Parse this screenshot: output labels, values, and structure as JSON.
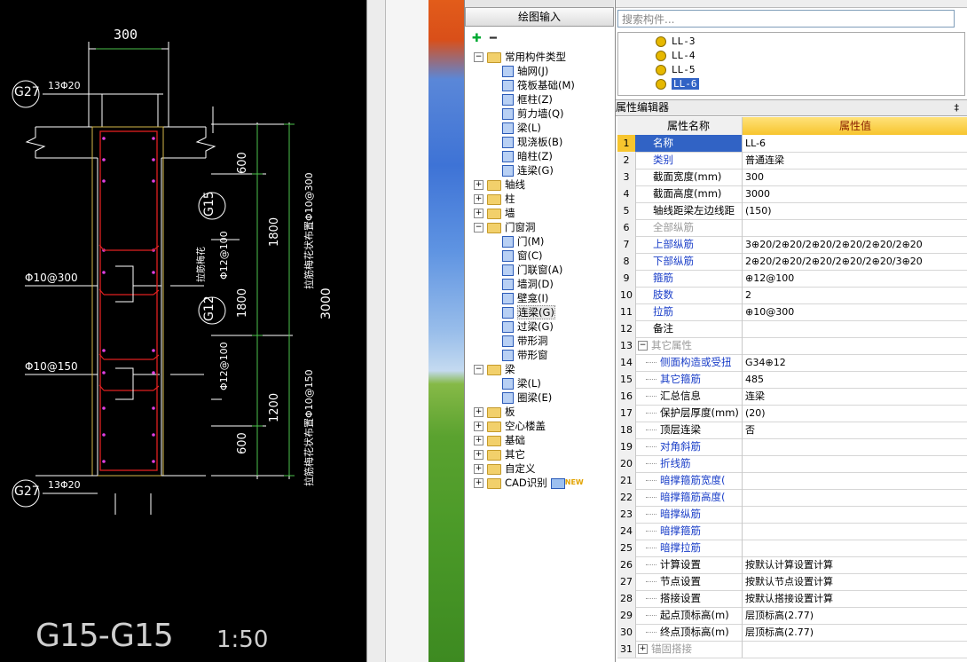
{
  "cad": {
    "dim_300": "300",
    "tag_g27_top": "G27",
    "rebar_top": "13Φ20",
    "tag_g15": "G15",
    "tag_g12": "G12",
    "tag_g27_bottom": "G27",
    "rebar_bottom": "13Φ20",
    "left_rebar_1": "Φ10@300",
    "left_rebar_2": "Φ10@150",
    "vert_rebar_1": "Φ12@100",
    "vert_rebar_2": "Φ12@100",
    "dim_600_top": "600",
    "dim_1800_a": "1800",
    "dim_1800_b": "1800",
    "dim_1200": "1200",
    "dim_600_bottom": "600",
    "dim_3000": "3000",
    "note_1": "拉筋梅花状布置Φ10@300",
    "note_2": "拉筋梅花状布置Φ10@150",
    "note_small": "拉筋梅花",
    "section_title": "G15-G15",
    "scale": "1:50"
  },
  "panel": {
    "draw_input": "绘图输入",
    "tree": [
      {
        "label": "常用构件类型",
        "type": "folder-open",
        "level": 0
      },
      {
        "label": "轴网(J)",
        "type": "item",
        "level": 1
      },
      {
        "label": "筏板基础(M)",
        "type": "item",
        "level": 1
      },
      {
        "label": "框柱(Z)",
        "type": "item",
        "level": 1
      },
      {
        "label": "剪力墙(Q)",
        "type": "item",
        "level": 1
      },
      {
        "label": "梁(L)",
        "type": "item",
        "level": 1
      },
      {
        "label": "现浇板(B)",
        "type": "item",
        "level": 1
      },
      {
        "label": "暗柱(Z)",
        "type": "item",
        "level": 1
      },
      {
        "label": "连梁(G)",
        "type": "item",
        "level": 1
      },
      {
        "label": "轴线",
        "type": "folder",
        "level": 0
      },
      {
        "label": "柱",
        "type": "folder",
        "level": 0
      },
      {
        "label": "墙",
        "type": "folder",
        "level": 0
      },
      {
        "label": "门窗洞",
        "type": "folder-open",
        "level": 0
      },
      {
        "label": "门(M)",
        "type": "item",
        "level": 1
      },
      {
        "label": "窗(C)",
        "type": "item",
        "level": 1
      },
      {
        "label": "门联窗(A)",
        "type": "item",
        "level": 1
      },
      {
        "label": "墙洞(D)",
        "type": "item",
        "level": 1
      },
      {
        "label": "壁龛(I)",
        "type": "item",
        "level": 1
      },
      {
        "label": "连梁(G)",
        "type": "item-selected",
        "level": 1
      },
      {
        "label": "过梁(G)",
        "type": "item",
        "level": 1
      },
      {
        "label": "带形洞",
        "type": "item",
        "level": 1
      },
      {
        "label": "带形窗",
        "type": "item",
        "level": 1
      },
      {
        "label": "梁",
        "type": "folder-open",
        "level": 0
      },
      {
        "label": "梁(L)",
        "type": "item",
        "level": 1
      },
      {
        "label": "圈梁(E)",
        "type": "item",
        "level": 1
      },
      {
        "label": "板",
        "type": "folder",
        "level": 0
      },
      {
        "label": "空心楼盖",
        "type": "folder",
        "level": 0
      },
      {
        "label": "基础",
        "type": "folder",
        "level": 0
      },
      {
        "label": "其它",
        "type": "folder",
        "level": 0
      },
      {
        "label": "自定义",
        "type": "folder",
        "level": 0
      },
      {
        "label": "CAD识别",
        "type": "folder-new",
        "level": 0
      }
    ],
    "new_badge": "NEW"
  },
  "right": {
    "search_placeholder": "搜索构件...",
    "components": [
      "LL-3",
      "LL-4",
      "LL-5",
      "LL-6"
    ],
    "selected_component": "LL-6",
    "editor_title": "属性编辑器",
    "col_name": "属性名称",
    "col_value": "属性值",
    "rows": [
      {
        "n": "1",
        "k": "名称",
        "v": "LL-6",
        "style": "sel"
      },
      {
        "n": "2",
        "k": "类别",
        "v": "普通连梁",
        "style": "blue"
      },
      {
        "n": "3",
        "k": "截面宽度(mm)",
        "v": "300",
        "style": "normal"
      },
      {
        "n": "4",
        "k": "截面高度(mm)",
        "v": "3000",
        "style": "normal"
      },
      {
        "n": "5",
        "k": "轴线距梁左边线距",
        "v": "(150)",
        "style": "normal"
      },
      {
        "n": "6",
        "k": "全部纵筋",
        "v": "",
        "style": "gray"
      },
      {
        "n": "7",
        "k": "上部纵筋",
        "v": "3⊕20/2⊕20/2⊕20/2⊕20/2⊕20/2⊕20",
        "style": "blue"
      },
      {
        "n": "8",
        "k": "下部纵筋",
        "v": "2⊕20/2⊕20/2⊕20/2⊕20/2⊕20/3⊕20",
        "style": "blue"
      },
      {
        "n": "9",
        "k": "箍筋",
        "v": "⊕12@100",
        "style": "blue"
      },
      {
        "n": "10",
        "k": "肢数",
        "v": "2",
        "style": "blue"
      },
      {
        "n": "11",
        "k": "拉筋",
        "v": "⊕10@300",
        "style": "blue"
      },
      {
        "n": "12",
        "k": "备注",
        "v": "",
        "style": "normal"
      },
      {
        "n": "13",
        "k": "其它属性",
        "v": "",
        "style": "gray-group"
      },
      {
        "n": "14",
        "k": "侧面构造或受扭",
        "v": "G34⊕12",
        "style": "blue-sub"
      },
      {
        "n": "15",
        "k": "其它箍筋",
        "v": "485",
        "style": "blue-sub"
      },
      {
        "n": "16",
        "k": "汇总信息",
        "v": "连梁",
        "style": "sub"
      },
      {
        "n": "17",
        "k": "保护层厚度(mm)",
        "v": "(20)",
        "style": "sub"
      },
      {
        "n": "18",
        "k": "顶层连梁",
        "v": "否",
        "style": "sub"
      },
      {
        "n": "19",
        "k": "对角斜筋",
        "v": "",
        "style": "blue-sub"
      },
      {
        "n": "20",
        "k": "折线筋",
        "v": "",
        "style": "blue-sub"
      },
      {
        "n": "21",
        "k": "暗撑箍筋宽度(",
        "v": "",
        "style": "blue-sub"
      },
      {
        "n": "22",
        "k": "暗撑箍筋高度(",
        "v": "",
        "style": "blue-sub"
      },
      {
        "n": "23",
        "k": "暗撑纵筋",
        "v": "",
        "style": "blue-sub"
      },
      {
        "n": "24",
        "k": "暗撑箍筋",
        "v": "",
        "style": "blue-sub"
      },
      {
        "n": "25",
        "k": "暗撑拉筋",
        "v": "",
        "style": "blue-sub"
      },
      {
        "n": "26",
        "k": "计算设置",
        "v": "按默认计算设置计算",
        "style": "sub"
      },
      {
        "n": "27",
        "k": "节点设置",
        "v": "按默认节点设置计算",
        "style": "sub"
      },
      {
        "n": "28",
        "k": "搭接设置",
        "v": "按默认搭接设置计算",
        "style": "sub"
      },
      {
        "n": "29",
        "k": "起点顶标高(m)",
        "v": "层顶标高(2.77)",
        "style": "sub"
      },
      {
        "n": "30",
        "k": "终点顶标高(m)",
        "v": "层顶标高(2.77)",
        "style": "sub"
      },
      {
        "n": "31",
        "k": "锚固搭接",
        "v": "",
        "style": "gray-group-collapsed"
      }
    ]
  }
}
